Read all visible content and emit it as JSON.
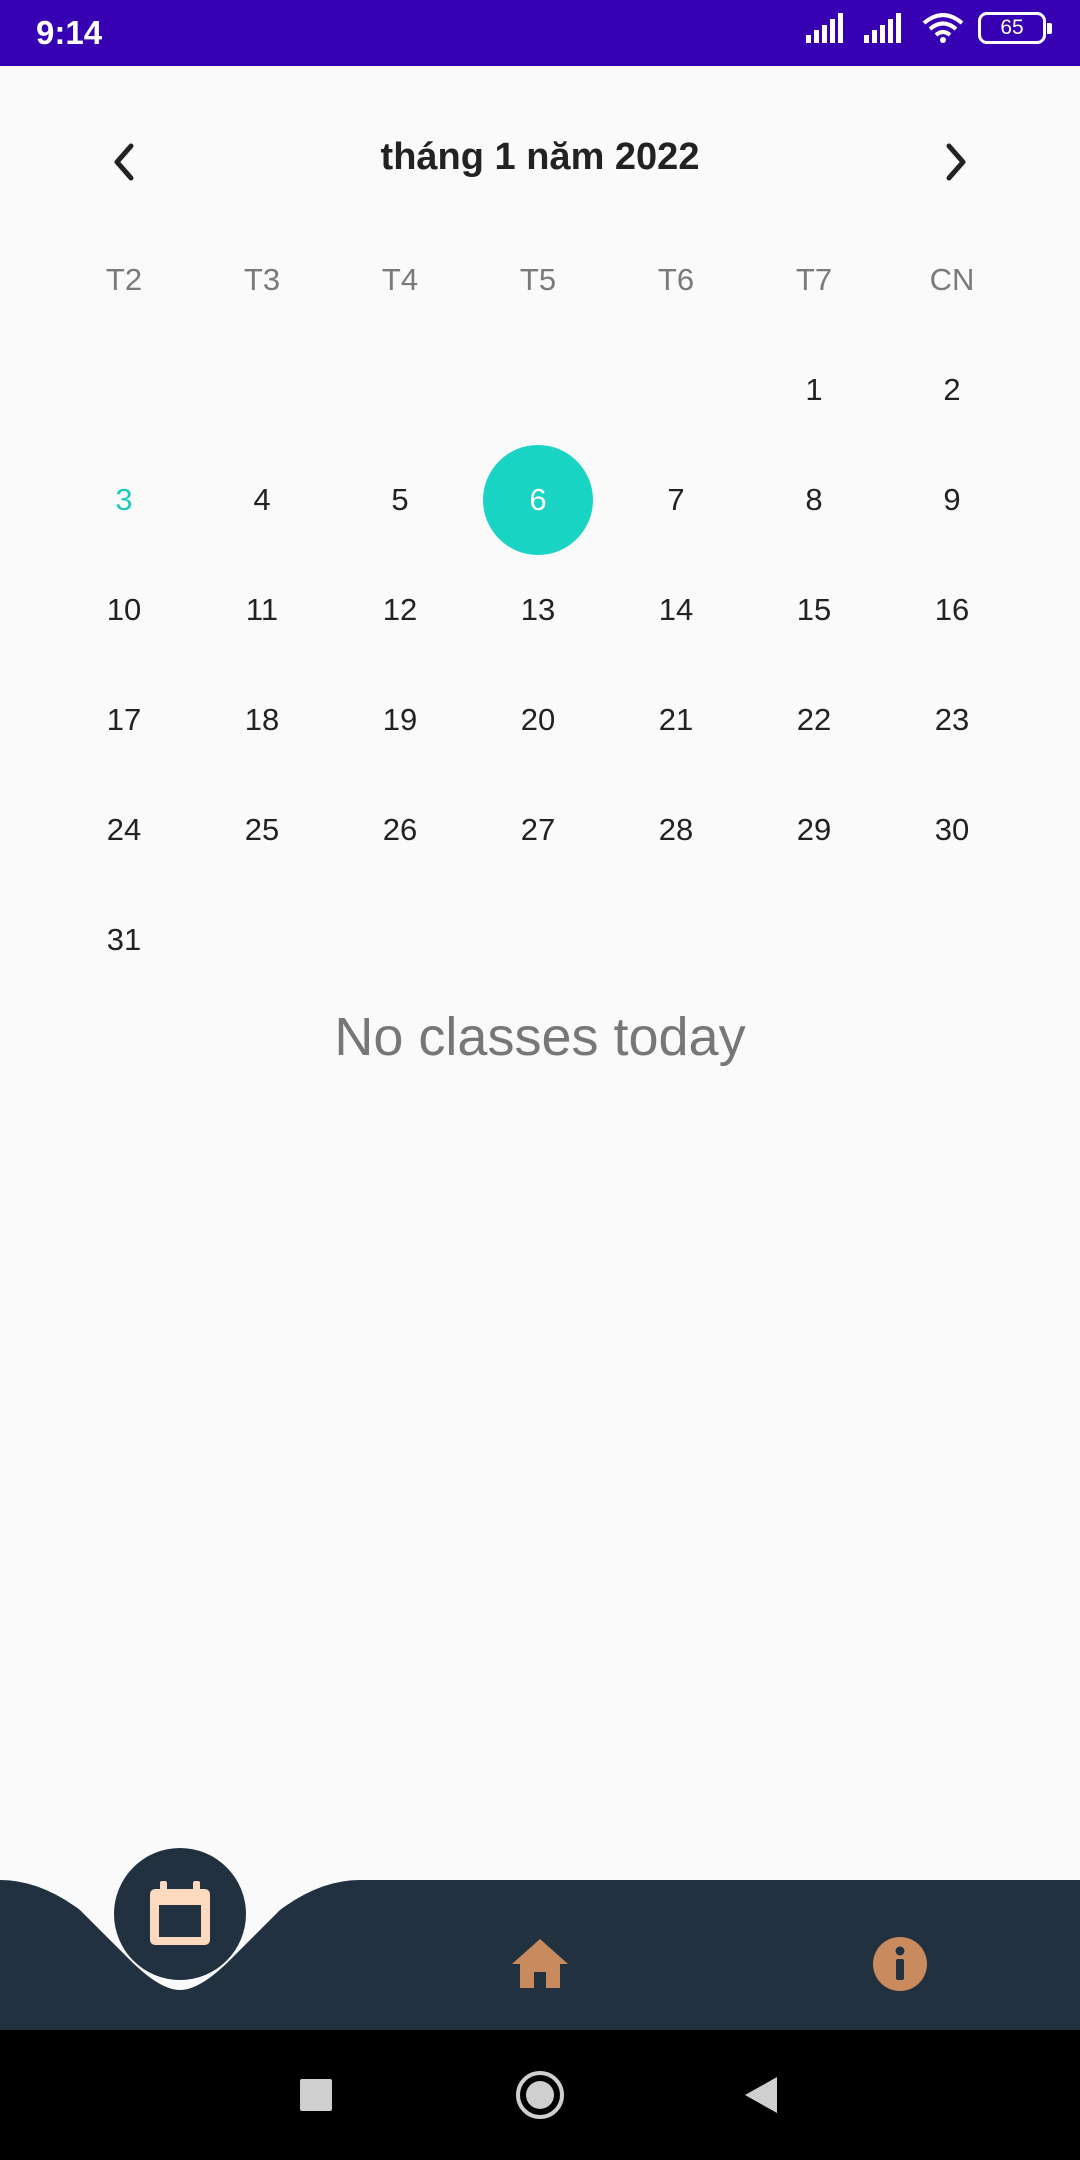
{
  "status_bar": {
    "time": "9:14",
    "battery": "65"
  },
  "calendar": {
    "title": "tháng 1 năm 2022",
    "weekdays": [
      "T2",
      "T3",
      "T4",
      "T5",
      "T6",
      "T7",
      "CN"
    ],
    "today_day": "3",
    "selected_day": "6",
    "weeks": [
      [
        "",
        "",
        "",
        "",
        "",
        "1",
        "2"
      ],
      [
        "3",
        "4",
        "5",
        "6",
        "7",
        "8",
        "9"
      ],
      [
        "10",
        "11",
        "12",
        "13",
        "14",
        "15",
        "16"
      ],
      [
        "17",
        "18",
        "19",
        "20",
        "21",
        "22",
        "23"
      ],
      [
        "24",
        "25",
        "26",
        "27",
        "28",
        "29",
        "30"
      ],
      [
        "31",
        "",
        "",
        "",
        "",
        "",
        ""
      ]
    ]
  },
  "empty_message": "No classes today",
  "bottom_nav": {
    "items": [
      {
        "icon": "calendar-icon",
        "active": true
      },
      {
        "icon": "home-icon",
        "active": false
      },
      {
        "icon": "info-icon",
        "active": false
      }
    ]
  },
  "colors": {
    "status_bar": "#3700b3",
    "accent": "#19d4c3",
    "nav_bg": "#213140",
    "nav_icon": "#c98b5e"
  }
}
